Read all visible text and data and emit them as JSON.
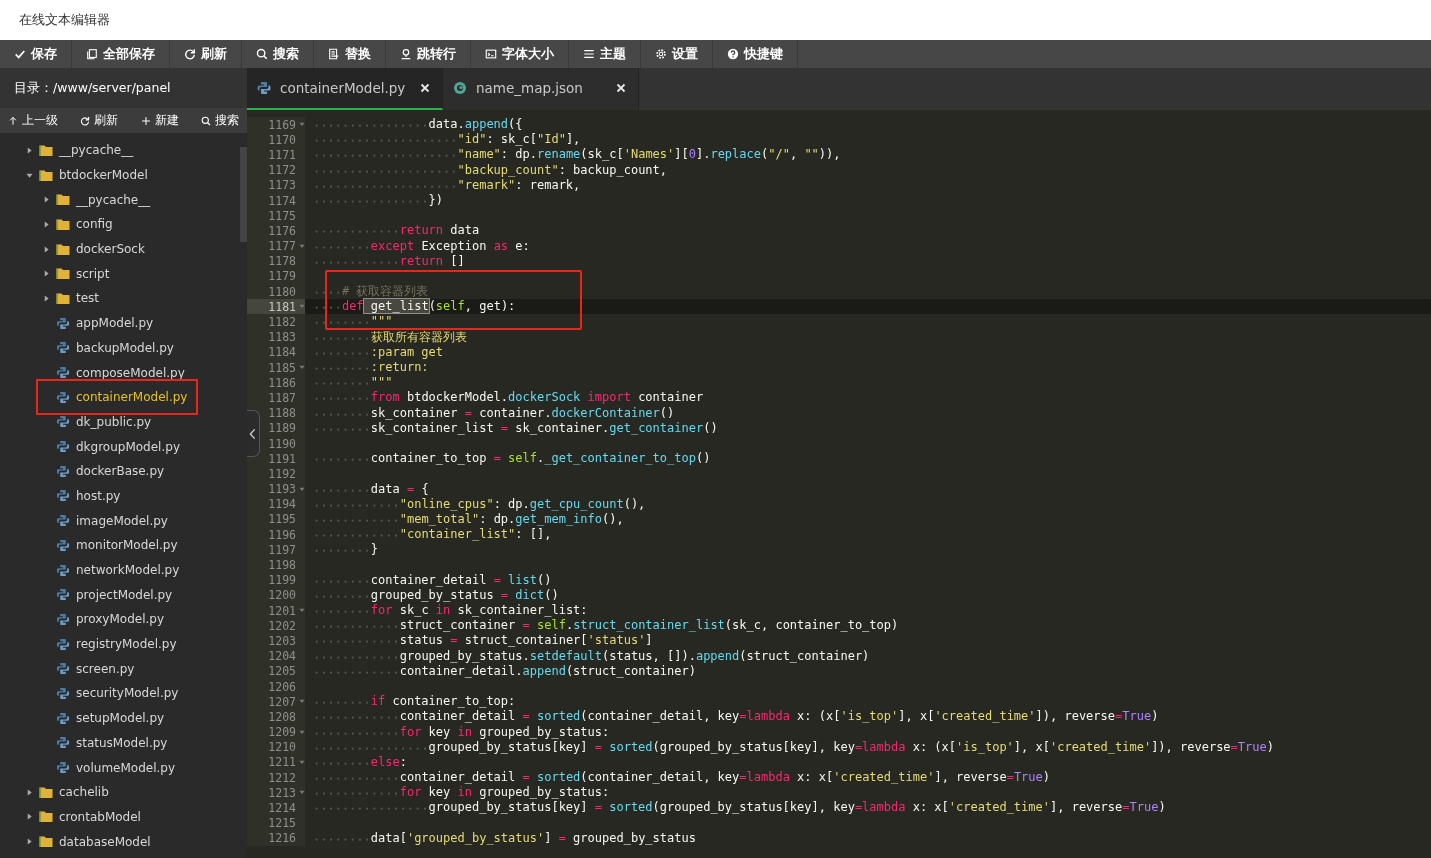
{
  "window": {
    "title": "在线文本编辑器"
  },
  "toolbar": [
    {
      "kind": "save",
      "label": "保存"
    },
    {
      "kind": "save-all",
      "label": "全部保存"
    },
    {
      "kind": "refresh",
      "label": "刷新"
    },
    {
      "kind": "search",
      "label": "搜索"
    },
    {
      "kind": "replace",
      "label": "替换"
    },
    {
      "kind": "goto",
      "label": "跳转行"
    },
    {
      "kind": "font",
      "label": "字体大小"
    },
    {
      "kind": "theme",
      "label": "主题"
    },
    {
      "kind": "settings",
      "label": "设置"
    },
    {
      "kind": "help",
      "label": "快捷键"
    }
  ],
  "sidebar": {
    "path": "目录：/www/server/panel",
    "actions": [
      {
        "kind": "up",
        "label": "上一级"
      },
      {
        "kind": "refresh",
        "label": "刷新"
      },
      {
        "kind": "new",
        "label": "新建"
      },
      {
        "kind": "search",
        "label": "搜索"
      }
    ],
    "tree": [
      {
        "kind": "folder",
        "name": "__pycache__",
        "expanded": false,
        "selected": false,
        "marked": false
      },
      {
        "kind": "folder",
        "name": "btdockerModel",
        "expanded": true,
        "selected": false,
        "marked": false,
        "children": [
          {
            "kind": "folder",
            "name": "__pycache__",
            "expanded": false,
            "selected": false,
            "marked": false
          },
          {
            "kind": "folder",
            "name": "config",
            "expanded": false,
            "selected": false,
            "marked": false
          },
          {
            "kind": "folder",
            "name": "dockerSock",
            "expanded": false,
            "selected": false,
            "marked": false
          },
          {
            "kind": "folder",
            "name": "script",
            "expanded": false,
            "selected": false,
            "marked": false
          },
          {
            "kind": "folder",
            "name": "test",
            "expanded": false,
            "selected": false,
            "marked": false
          },
          {
            "kind": "file",
            "name": "appModel.py",
            "selected": false,
            "marked": false
          },
          {
            "kind": "file",
            "name": "backupModel.py",
            "selected": false,
            "marked": false
          },
          {
            "kind": "file",
            "name": "composeModel.py",
            "selected": false,
            "marked": false
          },
          {
            "kind": "file",
            "name": "containerModel.py",
            "selected": true,
            "marked": true
          },
          {
            "kind": "file",
            "name": "dk_public.py",
            "selected": false,
            "marked": false
          },
          {
            "kind": "file",
            "name": "dkgroupModel.py",
            "selected": false,
            "marked": false
          },
          {
            "kind": "file",
            "name": "dockerBase.py",
            "selected": false,
            "marked": false
          },
          {
            "kind": "file",
            "name": "host.py",
            "selected": false,
            "marked": false
          },
          {
            "kind": "file",
            "name": "imageModel.py",
            "selected": false,
            "marked": false
          },
          {
            "kind": "file",
            "name": "monitorModel.py",
            "selected": false,
            "marked": false
          },
          {
            "kind": "file",
            "name": "networkModel.py",
            "selected": false,
            "marked": false
          },
          {
            "kind": "file",
            "name": "projectModel.py",
            "selected": false,
            "marked": false
          },
          {
            "kind": "file",
            "name": "proxyModel.py",
            "selected": false,
            "marked": false
          },
          {
            "kind": "file",
            "name": "registryModel.py",
            "selected": false,
            "marked": false
          },
          {
            "kind": "file",
            "name": "screen.py",
            "selected": false,
            "marked": false
          },
          {
            "kind": "file",
            "name": "securityModel.py",
            "selected": false,
            "marked": false
          },
          {
            "kind": "file",
            "name": "setupModel.py",
            "selected": false,
            "marked": false
          },
          {
            "kind": "file",
            "name": "statusModel.py",
            "selected": false,
            "marked": false
          },
          {
            "kind": "file",
            "name": "volumeModel.py",
            "selected": false,
            "marked": false
          }
        ]
      },
      {
        "kind": "folder",
        "name": "cachelib",
        "expanded": false,
        "selected": false,
        "marked": false
      },
      {
        "kind": "folder",
        "name": "crontabModel",
        "expanded": false,
        "selected": false,
        "marked": false
      },
      {
        "kind": "folder",
        "name": "databaseModel",
        "expanded": false,
        "selected": false,
        "marked": false
      }
    ]
  },
  "tabs": [
    {
      "kind": "py",
      "label": "containerModel.py",
      "selected": true
    },
    {
      "kind": "json",
      "label": "name_map.json",
      "selected": false
    }
  ],
  "editor": {
    "lines": [
      {
        "n": "1169",
        "fold": true,
        "active": false,
        "marked": false,
        "tokens": [
          {
            "kind": "plain",
            "text": "                data."
          },
          {
            "kind": "call",
            "text": "append"
          },
          {
            "kind": "plain",
            "text": "({"
          }
        ]
      },
      {
        "n": "1170",
        "fold": false,
        "active": false,
        "marked": false,
        "tokens": [
          {
            "kind": "string",
            "text": "                    \"id\""
          },
          {
            "kind": "plain",
            "text": ": sk_c["
          },
          {
            "kind": "string",
            "text": "\"Id\""
          },
          {
            "kind": "plain",
            "text": "],"
          }
        ]
      },
      {
        "n": "1171",
        "fold": false,
        "active": false,
        "marked": false,
        "tokens": [
          {
            "kind": "string",
            "text": "                    \"name\""
          },
          {
            "kind": "plain",
            "text": ": dp."
          },
          {
            "kind": "call",
            "text": "rename"
          },
          {
            "kind": "plain",
            "text": "(sk_c["
          },
          {
            "kind": "string",
            "text": "'Names'"
          },
          {
            "kind": "plain",
            "text": "]["
          },
          {
            "kind": "number",
            "text": "0"
          },
          {
            "kind": "plain",
            "text": "]."
          },
          {
            "kind": "call",
            "text": "replace"
          },
          {
            "kind": "plain",
            "text": "("
          },
          {
            "kind": "string",
            "text": "\"/\""
          },
          {
            "kind": "plain",
            "text": ", "
          },
          {
            "kind": "string",
            "text": "\"\""
          },
          {
            "kind": "plain",
            "text": ")),"
          }
        ]
      },
      {
        "n": "1172",
        "fold": false,
        "active": false,
        "marked": false,
        "tokens": [
          {
            "kind": "string",
            "text": "                    \"backup_count\""
          },
          {
            "kind": "plain",
            "text": ": backup_count,"
          }
        ]
      },
      {
        "n": "1173",
        "fold": false,
        "active": false,
        "marked": false,
        "tokens": [
          {
            "kind": "string",
            "text": "                    \"remark\""
          },
          {
            "kind": "plain",
            "text": ": remark,"
          }
        ]
      },
      {
        "n": "1174",
        "fold": false,
        "active": false,
        "marked": false,
        "tokens": [
          {
            "kind": "plain",
            "text": "                })"
          }
        ]
      },
      {
        "n": "1175",
        "fold": false,
        "active": false,
        "marked": false
      },
      {
        "n": "1176",
        "fold": false,
        "active": false,
        "marked": false,
        "tokens": [
          {
            "kind": "keyword",
            "text": "            return"
          },
          {
            "kind": "plain",
            "text": " data"
          }
        ]
      },
      {
        "n": "1177",
        "fold": true,
        "active": false,
        "marked": false,
        "tokens": [
          {
            "kind": "keyword",
            "text": "        except"
          },
          {
            "kind": "plain",
            "text": " Exception "
          },
          {
            "kind": "keyword",
            "text": "as"
          },
          {
            "kind": "plain",
            "text": " e:"
          }
        ]
      },
      {
        "n": "1178",
        "fold": false,
        "active": false,
        "marked": false,
        "tokens": [
          {
            "kind": "keyword",
            "text": "            return"
          },
          {
            "kind": "plain",
            "text": " []"
          }
        ]
      },
      {
        "n": "1179",
        "fold": false,
        "active": false,
        "marked": false
      },
      {
        "n": "1180",
        "fold": false,
        "active": false,
        "marked": true,
        "tokens": [
          {
            "kind": "comment",
            "text": "    # 获取容器列表"
          }
        ]
      },
      {
        "n": "1181",
        "fold": true,
        "active": true,
        "marked": true,
        "tokens": [
          {
            "kind": "keyword",
            "text": "    def"
          },
          {
            "kind": "match",
            "text": " get_list"
          },
          {
            "kind": "plain",
            "text": "("
          },
          {
            "kind": "self",
            "text": "self"
          },
          {
            "kind": "plain",
            "text": ", get):"
          }
        ]
      },
      {
        "n": "1182",
        "fold": false,
        "active": false,
        "marked": true,
        "tokens": [
          {
            "kind": "string",
            "text": "        \"\"\""
          }
        ]
      },
      {
        "n": "1183",
        "fold": false,
        "active": false,
        "marked": false,
        "tokens": [
          {
            "kind": "string",
            "text": "        获取所有容器列表"
          }
        ]
      },
      {
        "n": "1184",
        "fold": false,
        "active": false,
        "marked": false,
        "tokens": [
          {
            "kind": "string",
            "text": "        :param get"
          }
        ]
      },
      {
        "n": "1185",
        "fold": true,
        "active": false,
        "marked": false,
        "tokens": [
          {
            "kind": "string",
            "text": "        :return:"
          }
        ]
      },
      {
        "n": "1186",
        "fold": false,
        "active": false,
        "marked": false,
        "tokens": [
          {
            "kind": "string",
            "text": "        \"\"\""
          }
        ]
      },
      {
        "n": "1187",
        "fold": false,
        "active": false,
        "marked": false,
        "tokens": [
          {
            "kind": "keyword",
            "text": "        from"
          },
          {
            "kind": "plain",
            "text": " btdockerModel."
          },
          {
            "kind": "call",
            "text": "dockerSock"
          },
          {
            "kind": "keyword",
            "text": " import"
          },
          {
            "kind": "plain",
            "text": " container"
          }
        ]
      },
      {
        "n": "1188",
        "fold": false,
        "active": false,
        "marked": false,
        "tokens": [
          {
            "kind": "plain",
            "text": "        sk_container "
          },
          {
            "kind": "keyword",
            "text": "="
          },
          {
            "kind": "plain",
            "text": " container."
          },
          {
            "kind": "call",
            "text": "dockerContainer"
          },
          {
            "kind": "plain",
            "text": "()"
          }
        ]
      },
      {
        "n": "1189",
        "fold": false,
        "active": false,
        "marked": false,
        "tokens": [
          {
            "kind": "plain",
            "text": "        sk_container_list "
          },
          {
            "kind": "keyword",
            "text": "="
          },
          {
            "kind": "plain",
            "text": " sk_container."
          },
          {
            "kind": "call",
            "text": "get_container"
          },
          {
            "kind": "plain",
            "text": "()"
          }
        ]
      },
      {
        "n": "1190",
        "fold": false,
        "active": false,
        "marked": false
      },
      {
        "n": "1191",
        "fold": false,
        "active": false,
        "marked": false,
        "tokens": [
          {
            "kind": "plain",
            "text": "        container_to_top "
          },
          {
            "kind": "keyword",
            "text": "="
          },
          {
            "kind": "self",
            "text": " self"
          },
          {
            "kind": "plain",
            "text": "."
          },
          {
            "kind": "call",
            "text": "_get_container_to_top"
          },
          {
            "kind": "plain",
            "text": "()"
          }
        ]
      },
      {
        "n": "1192",
        "fold": false,
        "active": false,
        "marked": false
      },
      {
        "n": "1193",
        "fold": true,
        "active": false,
        "marked": false,
        "tokens": [
          {
            "kind": "plain",
            "text": "        data "
          },
          {
            "kind": "keyword",
            "text": "="
          },
          {
            "kind": "plain",
            "text": " {"
          }
        ]
      },
      {
        "n": "1194",
        "fold": false,
        "active": false,
        "marked": false,
        "tokens": [
          {
            "kind": "string",
            "text": "            \"online_cpus\""
          },
          {
            "kind": "plain",
            "text": ": dp."
          },
          {
            "kind": "call",
            "text": "get_cpu_count"
          },
          {
            "kind": "plain",
            "text": "(),"
          }
        ]
      },
      {
        "n": "1195",
        "fold": false,
        "active": false,
        "marked": false,
        "tokens": [
          {
            "kind": "string",
            "text": "            \"mem_total\""
          },
          {
            "kind": "plain",
            "text": ": dp."
          },
          {
            "kind": "call",
            "text": "get_mem_info"
          },
          {
            "kind": "plain",
            "text": "(),"
          }
        ]
      },
      {
        "n": "1196",
        "fold": false,
        "active": false,
        "marked": false,
        "tokens": [
          {
            "kind": "string",
            "text": "            \"container_list\""
          },
          {
            "kind": "plain",
            "text": ": [],"
          }
        ]
      },
      {
        "n": "1197",
        "fold": false,
        "active": false,
        "marked": false,
        "tokens": [
          {
            "kind": "plain",
            "text": "        }"
          }
        ]
      },
      {
        "n": "1198",
        "fold": false,
        "active": false,
        "marked": false
      },
      {
        "n": "1199",
        "fold": false,
        "active": false,
        "marked": false,
        "tokens": [
          {
            "kind": "plain",
            "text": "        container_detail "
          },
          {
            "kind": "keyword",
            "text": "="
          },
          {
            "kind": "call",
            "text": " list"
          },
          {
            "kind": "plain",
            "text": "()"
          }
        ]
      },
      {
        "n": "1200",
        "fold": false,
        "active": false,
        "marked": false,
        "tokens": [
          {
            "kind": "plain",
            "text": "        grouped_by_status "
          },
          {
            "kind": "keyword",
            "text": "="
          },
          {
            "kind": "call",
            "text": " dict"
          },
          {
            "kind": "plain",
            "text": "()"
          }
        ]
      },
      {
        "n": "1201",
        "fold": true,
        "active": false,
        "marked": false,
        "tokens": [
          {
            "kind": "keyword",
            "text": "        for"
          },
          {
            "kind": "plain",
            "text": " sk_c "
          },
          {
            "kind": "keyword",
            "text": "in"
          },
          {
            "kind": "plain",
            "text": " sk_container_list:"
          }
        ]
      },
      {
        "n": "1202",
        "fold": false,
        "active": false,
        "marked": false,
        "tokens": [
          {
            "kind": "plain",
            "text": "            struct_container "
          },
          {
            "kind": "keyword",
            "text": "="
          },
          {
            "kind": "self",
            "text": " self"
          },
          {
            "kind": "plain",
            "text": "."
          },
          {
            "kind": "call",
            "text": "struct_container_list"
          },
          {
            "kind": "plain",
            "text": "(sk_c, container_to_top)"
          }
        ]
      },
      {
        "n": "1203",
        "fold": false,
        "active": false,
        "marked": false,
        "tokens": [
          {
            "kind": "plain",
            "text": "            status "
          },
          {
            "kind": "keyword",
            "text": "="
          },
          {
            "kind": "plain",
            "text": " struct_container["
          },
          {
            "kind": "string",
            "text": "'status'"
          },
          {
            "kind": "plain",
            "text": "]"
          }
        ]
      },
      {
        "n": "1204",
        "fold": false,
        "active": false,
        "marked": false,
        "tokens": [
          {
            "kind": "plain",
            "text": "            grouped_by_status."
          },
          {
            "kind": "call",
            "text": "setdefault"
          },
          {
            "kind": "plain",
            "text": "(status, [])."
          },
          {
            "kind": "call",
            "text": "append"
          },
          {
            "kind": "plain",
            "text": "(struct_container)"
          }
        ]
      },
      {
        "n": "1205",
        "fold": false,
        "active": false,
        "marked": false,
        "tokens": [
          {
            "kind": "plain",
            "text": "            container_detail."
          },
          {
            "kind": "call",
            "text": "append"
          },
          {
            "kind": "plain",
            "text": "(struct_container)"
          }
        ]
      },
      {
        "n": "1206",
        "fold": false,
        "active": false,
        "marked": false
      },
      {
        "n": "1207",
        "fold": true,
        "active": false,
        "marked": false,
        "tokens": [
          {
            "kind": "keyword",
            "text": "        if"
          },
          {
            "kind": "plain",
            "text": " container_to_top:"
          }
        ]
      },
      {
        "n": "1208",
        "fold": false,
        "active": false,
        "marked": false,
        "tokens": [
          {
            "kind": "plain",
            "text": "            container_detail "
          },
          {
            "kind": "keyword",
            "text": "="
          },
          {
            "kind": "call",
            "text": " sorted"
          },
          {
            "kind": "plain",
            "text": "(container_detail, key"
          },
          {
            "kind": "keyword",
            "text": "="
          },
          {
            "kind": "keyword",
            "text": "lambda"
          },
          {
            "kind": "plain",
            "text": " x: (x["
          },
          {
            "kind": "string",
            "text": "'is_top'"
          },
          {
            "kind": "plain",
            "text": "], x["
          },
          {
            "kind": "string",
            "text": "'created_time'"
          },
          {
            "kind": "plain",
            "text": "]), reverse"
          },
          {
            "kind": "keyword",
            "text": "="
          },
          {
            "kind": "number",
            "text": "True"
          },
          {
            "kind": "plain",
            "text": ")"
          }
        ]
      },
      {
        "n": "1209",
        "fold": true,
        "active": false,
        "marked": false,
        "tokens": [
          {
            "kind": "keyword",
            "text": "            for"
          },
          {
            "kind": "plain",
            "text": " key "
          },
          {
            "kind": "keyword",
            "text": "in"
          },
          {
            "kind": "plain",
            "text": " grouped_by_status:"
          }
        ]
      },
      {
        "n": "1210",
        "fold": false,
        "active": false,
        "marked": false,
        "tokens": [
          {
            "kind": "plain",
            "text": "                grouped_by_status[key] "
          },
          {
            "kind": "keyword",
            "text": "="
          },
          {
            "kind": "call",
            "text": " sorted"
          },
          {
            "kind": "plain",
            "text": "(grouped_by_status[key], key"
          },
          {
            "kind": "keyword",
            "text": "="
          },
          {
            "kind": "keyword",
            "text": "lambda"
          },
          {
            "kind": "plain",
            "text": " x: (x["
          },
          {
            "kind": "string",
            "text": "'is_top'"
          },
          {
            "kind": "plain",
            "text": "], x["
          },
          {
            "kind": "string",
            "text": "'created_time'"
          },
          {
            "kind": "plain",
            "text": "]), reverse"
          },
          {
            "kind": "keyword",
            "text": "="
          },
          {
            "kind": "number",
            "text": "True"
          },
          {
            "kind": "plain",
            "text": ")"
          }
        ]
      },
      {
        "n": "1211",
        "fold": true,
        "active": false,
        "marked": false,
        "tokens": [
          {
            "kind": "keyword",
            "text": "        else"
          },
          {
            "kind": "plain",
            "text": ":"
          }
        ]
      },
      {
        "n": "1212",
        "fold": false,
        "active": false,
        "marked": false,
        "tokens": [
          {
            "kind": "plain",
            "text": "            container_detail "
          },
          {
            "kind": "keyword",
            "text": "="
          },
          {
            "kind": "call",
            "text": " sorted"
          },
          {
            "kind": "plain",
            "text": "(container_detail, key"
          },
          {
            "kind": "keyword",
            "text": "="
          },
          {
            "kind": "keyword",
            "text": "lambda"
          },
          {
            "kind": "plain",
            "text": " x: x["
          },
          {
            "kind": "string",
            "text": "'created_time'"
          },
          {
            "kind": "plain",
            "text": "], reverse"
          },
          {
            "kind": "keyword",
            "text": "="
          },
          {
            "kind": "number",
            "text": "True"
          },
          {
            "kind": "plain",
            "text": ")"
          }
        ]
      },
      {
        "n": "1213",
        "fold": true,
        "active": false,
        "marked": false,
        "tokens": [
          {
            "kind": "keyword",
            "text": "            for"
          },
          {
            "kind": "plain",
            "text": " key "
          },
          {
            "kind": "keyword",
            "text": "in"
          },
          {
            "kind": "plain",
            "text": " grouped_by_status:"
          }
        ]
      },
      {
        "n": "1214",
        "fold": false,
        "active": false,
        "marked": false,
        "tokens": [
          {
            "kind": "plain",
            "text": "                grouped_by_status[key] "
          },
          {
            "kind": "keyword",
            "text": "="
          },
          {
            "kind": "call",
            "text": " sorted"
          },
          {
            "kind": "plain",
            "text": "(grouped_by_status[key], key"
          },
          {
            "kind": "keyword",
            "text": "="
          },
          {
            "kind": "keyword",
            "text": "lambda"
          },
          {
            "kind": "plain",
            "text": " x: x["
          },
          {
            "kind": "string",
            "text": "'created_time'"
          },
          {
            "kind": "plain",
            "text": "], reverse"
          },
          {
            "kind": "keyword",
            "text": "="
          },
          {
            "kind": "number",
            "text": "True"
          },
          {
            "kind": "plain",
            "text": ")"
          }
        ]
      },
      {
        "n": "1215",
        "fold": false,
        "active": false,
        "marked": false
      },
      {
        "n": "1216",
        "fold": false,
        "active": false,
        "marked": false,
        "tokens": [
          {
            "kind": "plain",
            "text": "        data["
          },
          {
            "kind": "string",
            "text": "'grouped_by_status'"
          },
          {
            "kind": "plain",
            "text": "] "
          },
          {
            "kind": "keyword",
            "text": "="
          },
          {
            "kind": "plain",
            "text": " grouped_by_status"
          }
        ]
      }
    ]
  }
}
